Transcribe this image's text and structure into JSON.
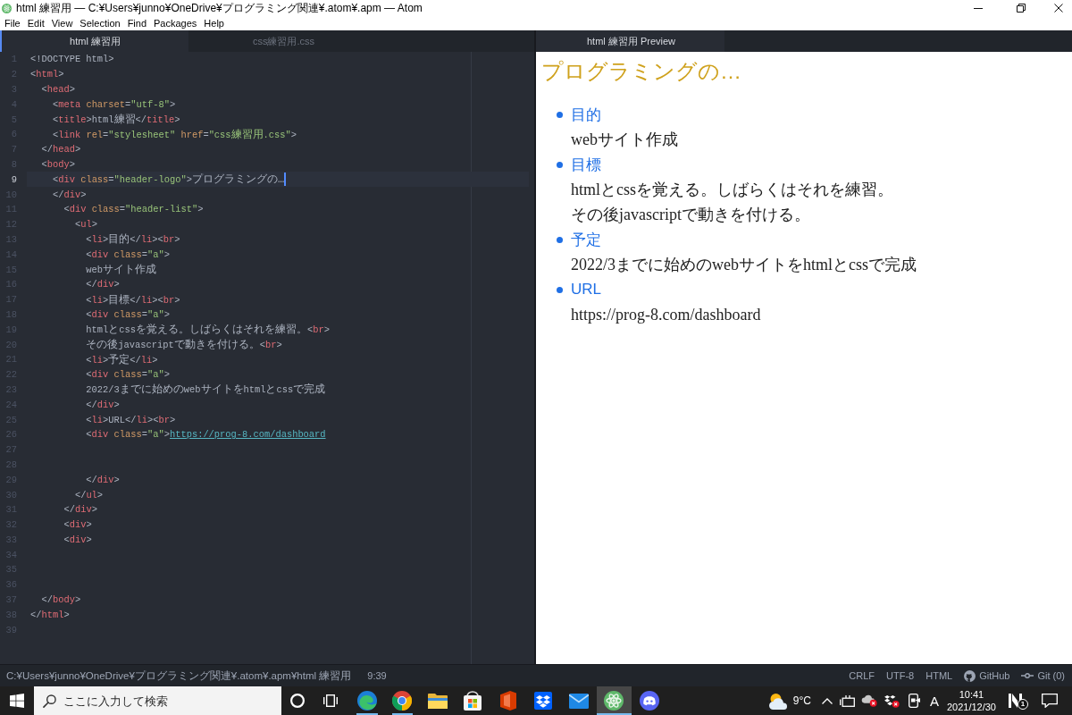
{
  "window": {
    "title": "html 練習用 — C:¥Users¥junno¥OneDrive¥プログラミング関連¥.atom¥.apm — Atom"
  },
  "menu": [
    {
      "label": "File"
    },
    {
      "label": "Edit"
    },
    {
      "label": "View"
    },
    {
      "label": "Selection"
    },
    {
      "label": "Find"
    },
    {
      "label": "Packages"
    },
    {
      "label": "Help"
    }
  ],
  "editor": {
    "tabs": [
      {
        "label": "html 練習用",
        "selected": true
      },
      {
        "label": "css練習用.css",
        "selected": false
      }
    ],
    "lines": [
      {
        "number": "1",
        "selected": false,
        "tokens": [
          {
            "kind": "plain",
            "text": "<!DOCTYPE html>"
          }
        ]
      },
      {
        "number": "2",
        "selected": false,
        "tokens": [
          {
            "kind": "plain",
            "text": "<"
          },
          {
            "kind": "tag",
            "text": "html"
          },
          {
            "kind": "plain",
            "text": ">"
          }
        ]
      },
      {
        "number": "3",
        "selected": false,
        "tokens": [
          {
            "kind": "plain",
            "text": "  <"
          },
          {
            "kind": "tag",
            "text": "head"
          },
          {
            "kind": "plain",
            "text": ">"
          }
        ]
      },
      {
        "number": "4",
        "selected": false,
        "tokens": [
          {
            "kind": "plain",
            "text": "    <"
          },
          {
            "kind": "tag",
            "text": "meta"
          },
          {
            "kind": "attr",
            "text": " charset"
          },
          {
            "kind": "plain",
            "text": "="
          },
          {
            "kind": "string",
            "text": "\"utf-8\""
          },
          {
            "kind": "plain",
            "text": ">"
          }
        ]
      },
      {
        "number": "5",
        "selected": false,
        "tokens": [
          {
            "kind": "plain",
            "text": "    <"
          },
          {
            "kind": "tag",
            "text": "title"
          },
          {
            "kind": "plain",
            "text": ">html練習</"
          },
          {
            "kind": "tag",
            "text": "title"
          },
          {
            "kind": "plain",
            "text": ">"
          }
        ]
      },
      {
        "number": "6",
        "selected": false,
        "tokens": [
          {
            "kind": "plain",
            "text": "    <"
          },
          {
            "kind": "tag",
            "text": "link"
          },
          {
            "kind": "attr",
            "text": " rel"
          },
          {
            "kind": "plain",
            "text": "="
          },
          {
            "kind": "string",
            "text": "\"stylesheet\""
          },
          {
            "kind": "attr",
            "text": " href"
          },
          {
            "kind": "plain",
            "text": "="
          },
          {
            "kind": "string",
            "text": "\"css練習用.css\""
          },
          {
            "kind": "plain",
            "text": ">"
          }
        ]
      },
      {
        "number": "7",
        "selected": false,
        "tokens": [
          {
            "kind": "plain",
            "text": "  </"
          },
          {
            "kind": "tag",
            "text": "head"
          },
          {
            "kind": "plain",
            "text": ">"
          }
        ]
      },
      {
        "number": "8",
        "selected": false,
        "tokens": [
          {
            "kind": "plain",
            "text": "  <"
          },
          {
            "kind": "tag",
            "text": "body"
          },
          {
            "kind": "plain",
            "text": ">"
          }
        ]
      },
      {
        "number": "9",
        "selected": true,
        "tokens": [
          {
            "kind": "plain",
            "text": "    <"
          },
          {
            "kind": "tag",
            "text": "div"
          },
          {
            "kind": "attr",
            "text": " class"
          },
          {
            "kind": "plain",
            "text": "="
          },
          {
            "kind": "string",
            "text": "\"header-logo\""
          },
          {
            "kind": "plain",
            "text": ">プログラミングの…"
          }
        ]
      },
      {
        "number": "10",
        "selected": false,
        "tokens": [
          {
            "kind": "plain",
            "text": "    </"
          },
          {
            "kind": "tag",
            "text": "div"
          },
          {
            "kind": "plain",
            "text": ">"
          }
        ]
      },
      {
        "number": "11",
        "selected": false,
        "tokens": [
          {
            "kind": "plain",
            "text": "      <"
          },
          {
            "kind": "tag",
            "text": "div"
          },
          {
            "kind": "attr",
            "text": " class"
          },
          {
            "kind": "plain",
            "text": "="
          },
          {
            "kind": "string",
            "text": "\"header-list\""
          },
          {
            "kind": "plain",
            "text": ">"
          }
        ]
      },
      {
        "number": "12",
        "selected": false,
        "tokens": [
          {
            "kind": "plain",
            "text": "        <"
          },
          {
            "kind": "tag",
            "text": "ul"
          },
          {
            "kind": "plain",
            "text": ">"
          }
        ]
      },
      {
        "number": "13",
        "selected": false,
        "tokens": [
          {
            "kind": "plain",
            "text": "          <"
          },
          {
            "kind": "tag",
            "text": "li"
          },
          {
            "kind": "plain",
            "text": ">目的</"
          },
          {
            "kind": "tag",
            "text": "li"
          },
          {
            "kind": "plain",
            "text": "><"
          },
          {
            "kind": "tag",
            "text": "br"
          },
          {
            "kind": "plain",
            "text": ">"
          }
        ]
      },
      {
        "number": "14",
        "selected": false,
        "tokens": [
          {
            "kind": "plain",
            "text": "          <"
          },
          {
            "kind": "tag",
            "text": "div"
          },
          {
            "kind": "attr",
            "text": " class"
          },
          {
            "kind": "plain",
            "text": "="
          },
          {
            "kind": "string",
            "text": "\"a\""
          },
          {
            "kind": "plain",
            "text": ">"
          }
        ]
      },
      {
        "number": "15",
        "selected": false,
        "tokens": [
          {
            "kind": "plain",
            "text": "          webサイト作成"
          }
        ]
      },
      {
        "number": "16",
        "selected": false,
        "tokens": [
          {
            "kind": "plain",
            "text": "          </"
          },
          {
            "kind": "tag",
            "text": "div"
          },
          {
            "kind": "plain",
            "text": ">"
          }
        ]
      },
      {
        "number": "17",
        "selected": false,
        "tokens": [
          {
            "kind": "plain",
            "text": "          <"
          },
          {
            "kind": "tag",
            "text": "li"
          },
          {
            "kind": "plain",
            "text": ">目標</"
          },
          {
            "kind": "tag",
            "text": "li"
          },
          {
            "kind": "plain",
            "text": "><"
          },
          {
            "kind": "tag",
            "text": "br"
          },
          {
            "kind": "plain",
            "text": ">"
          }
        ]
      },
      {
        "number": "18",
        "selected": false,
        "tokens": [
          {
            "kind": "plain",
            "text": "          <"
          },
          {
            "kind": "tag",
            "text": "div"
          },
          {
            "kind": "attr",
            "text": " class"
          },
          {
            "kind": "plain",
            "text": "="
          },
          {
            "kind": "string",
            "text": "\"a\""
          },
          {
            "kind": "plain",
            "text": ">"
          }
        ]
      },
      {
        "number": "19",
        "selected": false,
        "tokens": [
          {
            "kind": "plain",
            "text": "          htmlとcssを覚える。しばらくはそれを練習。<"
          },
          {
            "kind": "tag",
            "text": "br"
          },
          {
            "kind": "plain",
            "text": ">"
          }
        ]
      },
      {
        "number": "20",
        "selected": false,
        "tokens": [
          {
            "kind": "plain",
            "text": "          その後javascriptで動きを付ける。<"
          },
          {
            "kind": "tag",
            "text": "br"
          },
          {
            "kind": "plain",
            "text": ">"
          }
        ]
      },
      {
        "number": "21",
        "selected": false,
        "tokens": [
          {
            "kind": "plain",
            "text": "          <"
          },
          {
            "kind": "tag",
            "text": "li"
          },
          {
            "kind": "plain",
            "text": ">予定</"
          },
          {
            "kind": "tag",
            "text": "li"
          },
          {
            "kind": "plain",
            "text": ">"
          }
        ]
      },
      {
        "number": "22",
        "selected": false,
        "tokens": [
          {
            "kind": "plain",
            "text": "          <"
          },
          {
            "kind": "tag",
            "text": "div"
          },
          {
            "kind": "attr",
            "text": " class"
          },
          {
            "kind": "plain",
            "text": "="
          },
          {
            "kind": "string",
            "text": "\"a\""
          },
          {
            "kind": "plain",
            "text": ">"
          }
        ]
      },
      {
        "number": "23",
        "selected": false,
        "tokens": [
          {
            "kind": "plain",
            "text": "          2022/3までに始めのwebサイトをhtmlとcssで完成"
          }
        ]
      },
      {
        "number": "24",
        "selected": false,
        "tokens": [
          {
            "kind": "plain",
            "text": "          </"
          },
          {
            "kind": "tag",
            "text": "div"
          },
          {
            "kind": "plain",
            "text": ">"
          }
        ]
      },
      {
        "number": "25",
        "selected": false,
        "tokens": [
          {
            "kind": "plain",
            "text": "          <"
          },
          {
            "kind": "tag",
            "text": "li"
          },
          {
            "kind": "plain",
            "text": ">URL</"
          },
          {
            "kind": "tag",
            "text": "li"
          },
          {
            "kind": "plain",
            "text": "><"
          },
          {
            "kind": "tag",
            "text": "br"
          },
          {
            "kind": "plain",
            "text": ">"
          }
        ]
      },
      {
        "number": "26",
        "selected": false,
        "tokens": [
          {
            "kind": "plain",
            "text": "          <"
          },
          {
            "kind": "tag",
            "text": "div"
          },
          {
            "kind": "attr",
            "text": " class"
          },
          {
            "kind": "plain",
            "text": "="
          },
          {
            "kind": "string",
            "text": "\"a\""
          },
          {
            "kind": "plain",
            "text": ">"
          },
          {
            "kind": "link",
            "text": "https://prog-8.com/dashboard"
          }
        ]
      },
      {
        "number": "27",
        "selected": false
      },
      {
        "number": "28",
        "selected": false
      },
      {
        "number": "29",
        "selected": false,
        "tokens": [
          {
            "kind": "plain",
            "text": "          </"
          },
          {
            "kind": "tag",
            "text": "div"
          },
          {
            "kind": "plain",
            "text": ">"
          }
        ]
      },
      {
        "number": "30",
        "selected": false,
        "tokens": [
          {
            "kind": "plain",
            "text": "        </"
          },
          {
            "kind": "tag",
            "text": "ul"
          },
          {
            "kind": "plain",
            "text": ">"
          }
        ]
      },
      {
        "number": "31",
        "selected": false,
        "tokens": [
          {
            "kind": "plain",
            "text": "      </"
          },
          {
            "kind": "tag",
            "text": "div"
          },
          {
            "kind": "plain",
            "text": ">"
          }
        ]
      },
      {
        "number": "32",
        "selected": false,
        "tokens": [
          {
            "kind": "plain",
            "text": "      <"
          },
          {
            "kind": "tag",
            "text": "div"
          },
          {
            "kind": "plain",
            "text": ">"
          }
        ]
      },
      {
        "number": "33",
        "selected": false,
        "tokens": [
          {
            "kind": "plain",
            "text": "      <"
          },
          {
            "kind": "tag",
            "text": "div"
          },
          {
            "kind": "plain",
            "text": ">"
          }
        ]
      },
      {
        "number": "34",
        "selected": false
      },
      {
        "number": "35",
        "selected": false
      },
      {
        "number": "36",
        "selected": false
      },
      {
        "number": "37",
        "selected": false,
        "tokens": [
          {
            "kind": "plain",
            "text": "  </"
          },
          {
            "kind": "tag",
            "text": "body"
          },
          {
            "kind": "plain",
            "text": ">"
          }
        ]
      },
      {
        "number": "38",
        "selected": false,
        "tokens": [
          {
            "kind": "plain",
            "text": "</"
          },
          {
            "kind": "tag",
            "text": "html"
          },
          {
            "kind": "plain",
            "text": ">"
          }
        ]
      },
      {
        "number": "39",
        "selected": false
      }
    ]
  },
  "preview": {
    "tab": {
      "label": "html 練習用 Preview",
      "selected": true
    },
    "heading": "プログラミングの…",
    "items": [
      {
        "label": "目的",
        "lines": [
          "webサイト作成"
        ]
      },
      {
        "label": "目標",
        "lines": [
          "htmlとcssを覚える。しばらくはそれを練習。",
          "その後javascriptで動きを付ける。"
        ]
      },
      {
        "label": "予定",
        "lines": [
          "2022/3までに始めのwebサイトをhtmlとcssで完成"
        ]
      },
      {
        "label": "URL",
        "lines": [
          "https://prog-8.com/dashboard"
        ]
      }
    ]
  },
  "status_bar": {
    "path": "C:¥Users¥junno¥OneDrive¥プログラミング関連¥.atom¥.apm¥html 練習用",
    "cursor": "9:39",
    "items": [
      {
        "kind": "plain",
        "label": "CRLF"
      },
      {
        "kind": "plain",
        "label": "UTF-8"
      },
      {
        "kind": "plain",
        "label": "HTML"
      },
      {
        "kind": "github",
        "label": "GitHub"
      },
      {
        "kind": "git",
        "label": "Git (0)"
      }
    ]
  },
  "taskbar": {
    "search": {
      "placeholder": "ここに入力して検索"
    },
    "apps": [
      {
        "kind": "swirl",
        "running": true,
        "selected": false
      },
      {
        "kind": "wheel",
        "running": true,
        "selected": false
      },
      {
        "kind": "folder",
        "running": false,
        "selected": false
      },
      {
        "kind": "bag",
        "running": false,
        "selected": false
      },
      {
        "kind": "office",
        "running": false,
        "selected": false
      },
      {
        "kind": "boxes",
        "running": false,
        "selected": false
      },
      {
        "kind": "mail",
        "running": false,
        "selected": false
      },
      {
        "kind": "atom",
        "running": true,
        "selected": true
      },
      {
        "kind": "gamepad",
        "running": false,
        "selected": false
      }
    ],
    "temperature": "9°C",
    "ime": "A",
    "time": "10:41",
    "date": "2021/12/30",
    "notification_badge": "1"
  }
}
